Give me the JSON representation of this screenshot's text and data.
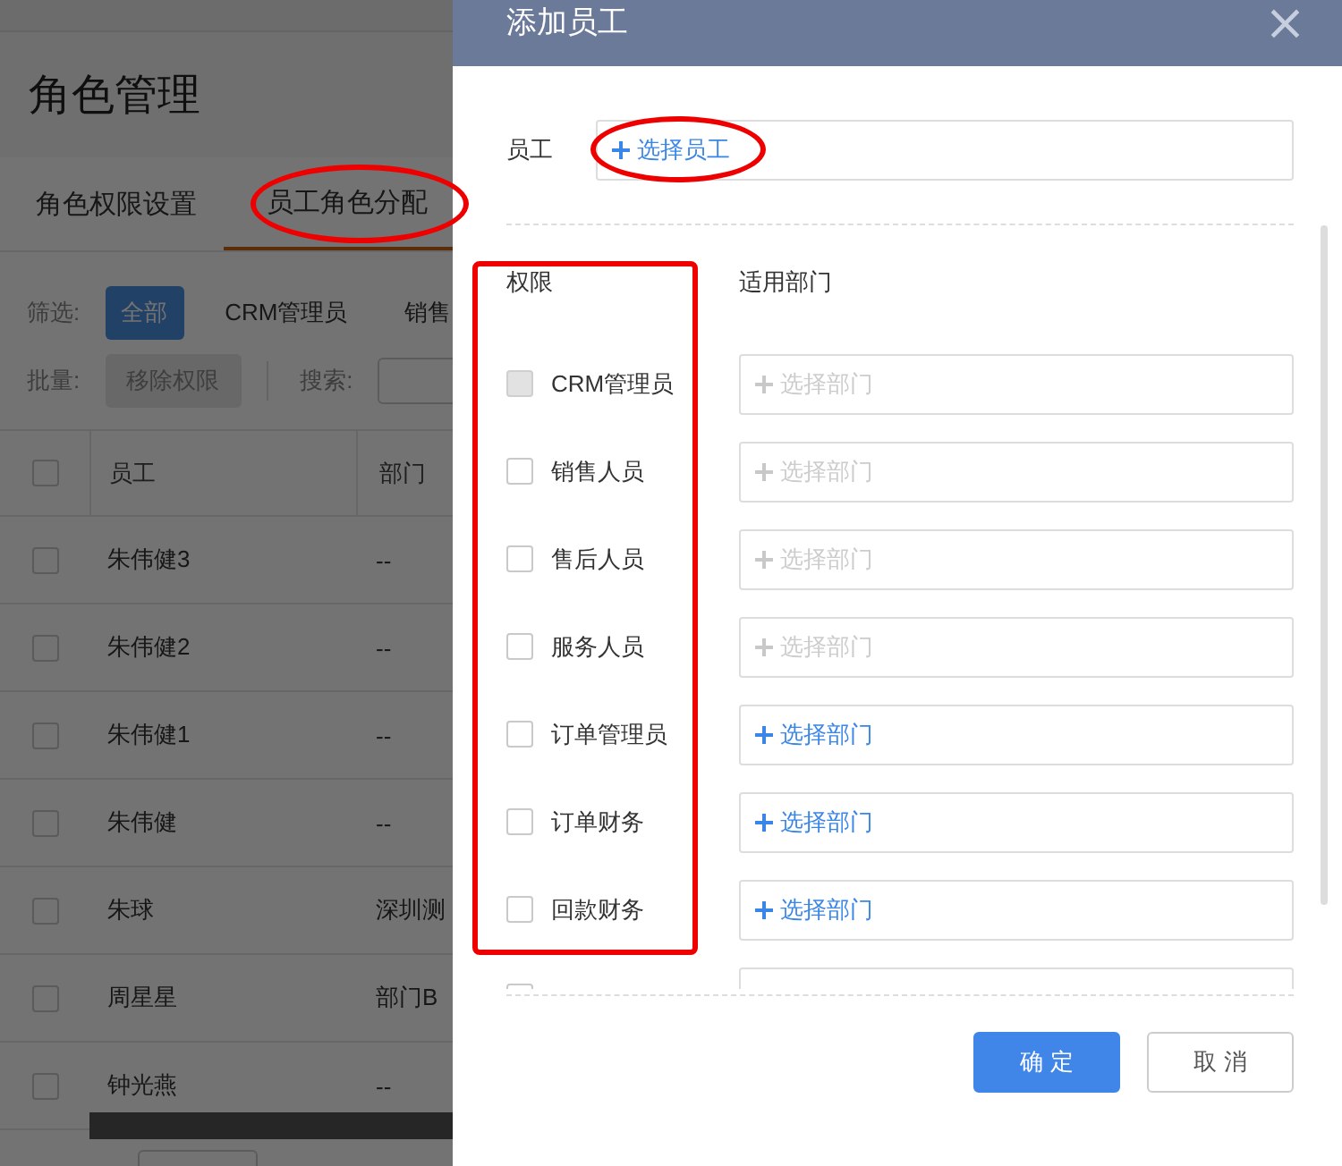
{
  "page": {
    "title": "角色管理",
    "tabs": [
      {
        "label": "角色权限设置",
        "selected": false
      },
      {
        "label": "员工角色分配",
        "selected": true
      }
    ],
    "filter": {
      "label": "筛选:",
      "options": [
        {
          "label": "全部",
          "selected": true
        },
        {
          "label": "CRM管理员",
          "selected": false
        },
        {
          "label": "销售",
          "selected": false
        }
      ]
    },
    "batch": {
      "label": "批量:",
      "button": "移除权限",
      "search_label": "搜索:"
    },
    "table": {
      "columns": [
        "员工",
        "部门"
      ],
      "all_checked": false,
      "rows": [
        {
          "employee": "朱伟健3",
          "department": "--",
          "checked": false
        },
        {
          "employee": "朱伟健2",
          "department": "--",
          "checked": false
        },
        {
          "employee": "朱伟健1",
          "department": "--",
          "checked": false
        },
        {
          "employee": "朱伟健",
          "department": "--",
          "checked": false
        },
        {
          "employee": "朱球",
          "department": "深圳测",
          "checked": false
        },
        {
          "employee": "周星星",
          "department": "部门B",
          "checked": false
        },
        {
          "employee": "钟光燕",
          "department": "--",
          "checked": false
        }
      ]
    }
  },
  "dialog": {
    "title": "添加员工",
    "close": "×",
    "employee_label": "员工",
    "employee_picker": "选择员工",
    "columns": [
      "权限",
      "适用部门"
    ],
    "roles": [
      {
        "label": "CRM管理员",
        "checked": false,
        "locked": true,
        "dept_enabled": false,
        "dept_picker": "选择部门"
      },
      {
        "label": "销售人员",
        "checked": false,
        "locked": false,
        "dept_enabled": false,
        "dept_picker": "选择部门"
      },
      {
        "label": "售后人员",
        "checked": false,
        "locked": false,
        "dept_enabled": false,
        "dept_picker": "选择部门"
      },
      {
        "label": "服务人员",
        "checked": false,
        "locked": false,
        "dept_enabled": false,
        "dept_picker": "选择部门"
      },
      {
        "label": "订单管理员",
        "checked": false,
        "locked": false,
        "dept_enabled": true,
        "dept_picker": "选择部门"
      },
      {
        "label": "订单财务",
        "checked": false,
        "locked": false,
        "dept_enabled": true,
        "dept_picker": "选择部门"
      },
      {
        "label": "回款财务",
        "checked": false,
        "locked": false,
        "dept_enabled": true,
        "dept_picker": "选择部门"
      },
      {
        "checked": false,
        "locked": false
      }
    ],
    "buttons": [
      {
        "label": "确 定",
        "kind": "primary"
      },
      {
        "label": "取 消",
        "kind": "secondary"
      }
    ]
  },
  "annotations": [
    {
      "kind": "ellipse"
    },
    {
      "kind": "ellipse"
    },
    {
      "kind": "rect"
    }
  ]
}
